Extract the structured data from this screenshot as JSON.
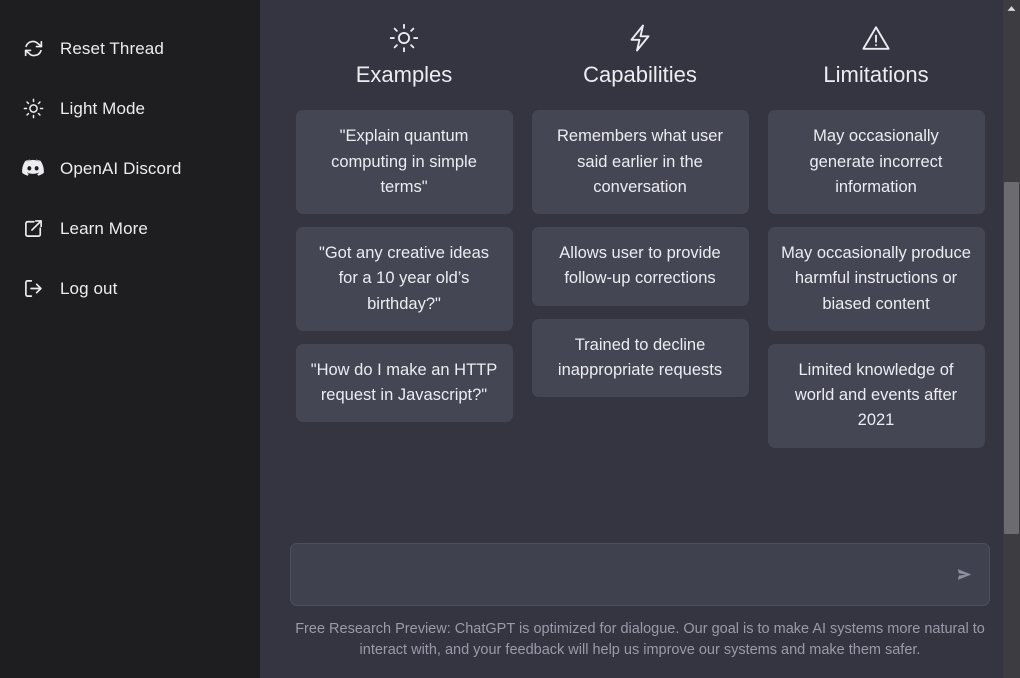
{
  "sidebar": {
    "items": [
      {
        "label": "Reset Thread",
        "icon": "reset-icon"
      },
      {
        "label": "Light Mode",
        "icon": "sun-icon"
      },
      {
        "label": "OpenAI Discord",
        "icon": "discord-icon"
      },
      {
        "label": "Learn More",
        "icon": "external-link-icon"
      },
      {
        "label": "Log out",
        "icon": "logout-icon"
      }
    ]
  },
  "main": {
    "columns": [
      {
        "title": "Examples",
        "icon": "sun-icon",
        "cards": [
          "\"Explain quantum computing in simple terms\"",
          "\"Got any creative ideas for a 10 year old’s birthday?\"",
          "\"How do I make an HTTP request in Javascript?\""
        ]
      },
      {
        "title": "Capabilities",
        "icon": "lightning-bolt-icon",
        "cards": [
          "Remembers what user said earlier in the conversation",
          "Allows user to provide follow-up corrections",
          "Trained to decline inappropriate requests"
        ]
      },
      {
        "title": "Limitations",
        "icon": "warning-triangle-icon",
        "cards": [
          "May occasionally generate incorrect information",
          "May occasionally produce harmful instructions or biased content",
          "Limited knowledge of world and events after 2021"
        ]
      }
    ]
  },
  "composer": {
    "value": "",
    "placeholder": "",
    "send_icon": "send-icon"
  },
  "footer": {
    "note": "Free Research Preview: ChatGPT is optimized for dialogue. Our goal is to make AI systems more natural to interact with, and your feedback will help us improve our systems and make them safer."
  },
  "colors": {
    "sidebar_bg": "#1e1e20",
    "main_bg": "#343541",
    "card_bg": "#444654",
    "composer_bg": "#40414f",
    "text": "#ececf1",
    "muted_text": "#9a9aab",
    "scrollbar_track": "#3c3c41",
    "scrollbar_thumb": "#6b6b70"
  }
}
